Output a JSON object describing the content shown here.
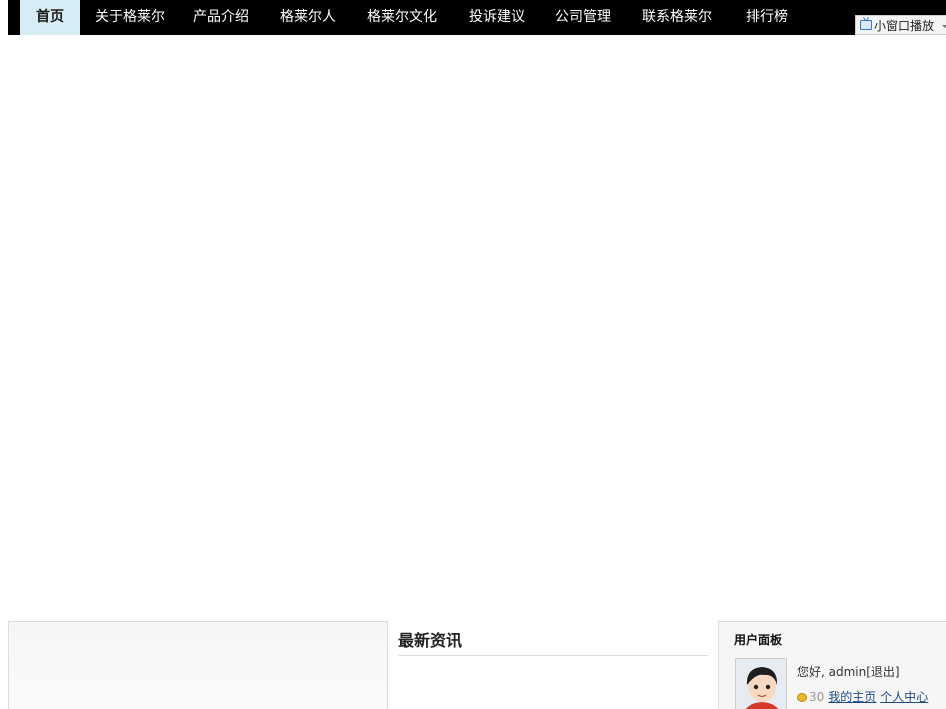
{
  "nav": {
    "items": [
      {
        "label": "首页",
        "active": true
      },
      {
        "label": "关于格莱尔"
      },
      {
        "label": "产品介绍"
      },
      {
        "label": "格莱尔人"
      },
      {
        "label": "格莱尔文化"
      },
      {
        "label": "投诉建议"
      },
      {
        "label": "公司管理"
      },
      {
        "label": "联系格莱尔"
      },
      {
        "label": "排行榜"
      }
    ]
  },
  "mini_player": {
    "label": "小窗口播放",
    "icon": "tv-icon"
  },
  "news": {
    "title": "最新资讯"
  },
  "user_panel": {
    "title": "用户面板",
    "greeting": "您好, admin[退出]",
    "points": "30",
    "my_home": "我的主页",
    "personal_center": "个人中心"
  },
  "colors": {
    "nav_bg": "#000000",
    "nav_active_bg": "#d7edf5",
    "link": "#1f4b87"
  }
}
